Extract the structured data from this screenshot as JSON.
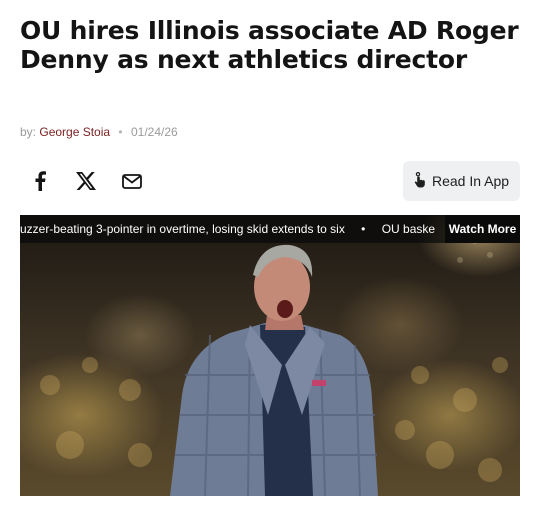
{
  "article": {
    "headline": "OU hires Illinois associate AD Roger Denny as next athletics director",
    "byline_prefix": "by:",
    "author": "George Stoia",
    "date": "01/24/26"
  },
  "share": {
    "icons": [
      "facebook-icon",
      "x-twitter-icon",
      "email-icon"
    ],
    "read_in_app_label": "Read In App"
  },
  "video": {
    "ticker_items": [
      "uzzer-beating 3-pointer in overtime, losing skid extends to six",
      "OU baske"
    ],
    "ticker_separator": "•",
    "watch_more_label": "Watch More"
  }
}
